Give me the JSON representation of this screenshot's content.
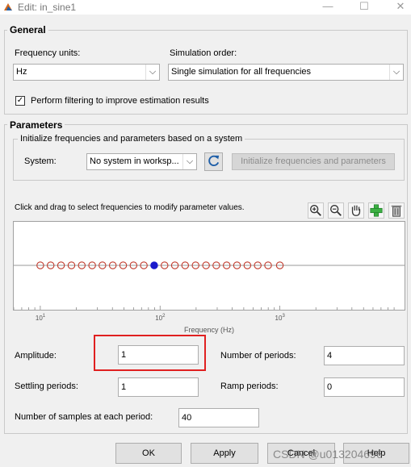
{
  "window": {
    "title": "Edit: in_sine1",
    "minimize": "—",
    "maximize": "☐",
    "close": "✕"
  },
  "general": {
    "title": "General",
    "freq_units_label": "Frequency units:",
    "freq_units_value": "Hz",
    "sim_order_label": "Simulation order:",
    "sim_order_value": "Single simulation for all frequencies",
    "filter_checked": true,
    "filter_label": "Perform filtering to improve estimation results"
  },
  "parameters": {
    "title": "Parameters",
    "init_title": "Initialize frequencies and parameters based on a system",
    "system_label": "System:",
    "system_value": "No system in worksp...",
    "init_button": "Initialize frequencies and parameters",
    "instruction": "Click and drag to select frequencies to modify parameter values.",
    "amplitude_label": "Amplitude:",
    "amplitude_value": "1",
    "num_periods_label": "Number of periods:",
    "num_periods_value": "4",
    "settling_label": "Settling periods:",
    "settling_value": "1",
    "ramp_label": "Ramp periods:",
    "ramp_value": "0",
    "samples_label": "Number of samples at each period:",
    "samples_value": "40"
  },
  "chart_data": {
    "type": "scatter",
    "xlabel": "Frequency (Hz)",
    "xscale": "log",
    "xlim": [
      6,
      11000
    ],
    "xticks": [
      {
        "base": "10",
        "exp": "1",
        "value": 10
      },
      {
        "base": "10",
        "exp": "2",
        "value": 100
      },
      {
        "base": "10",
        "exp": "3",
        "value": 1000
      }
    ],
    "frequencies": [
      10,
      12.2,
      14.9,
      18.2,
      22.2,
      27.1,
      33.0,
      40.3,
      49.2,
      60.0,
      73.2,
      89.3,
      109,
      133,
      162,
      198,
      242,
      295,
      360,
      439,
      536,
      654,
      798,
      1000
    ],
    "selected_frequencies": [
      89.3
    ],
    "colors": {
      "marker": "#c0392b",
      "selected": "#1a1acc",
      "axis": "#9a9a9a"
    }
  },
  "buttons": {
    "ok": "OK",
    "apply": "Apply",
    "cancel": "Cancel",
    "help": "Help"
  },
  "watermark": "CSDN @u013204696"
}
